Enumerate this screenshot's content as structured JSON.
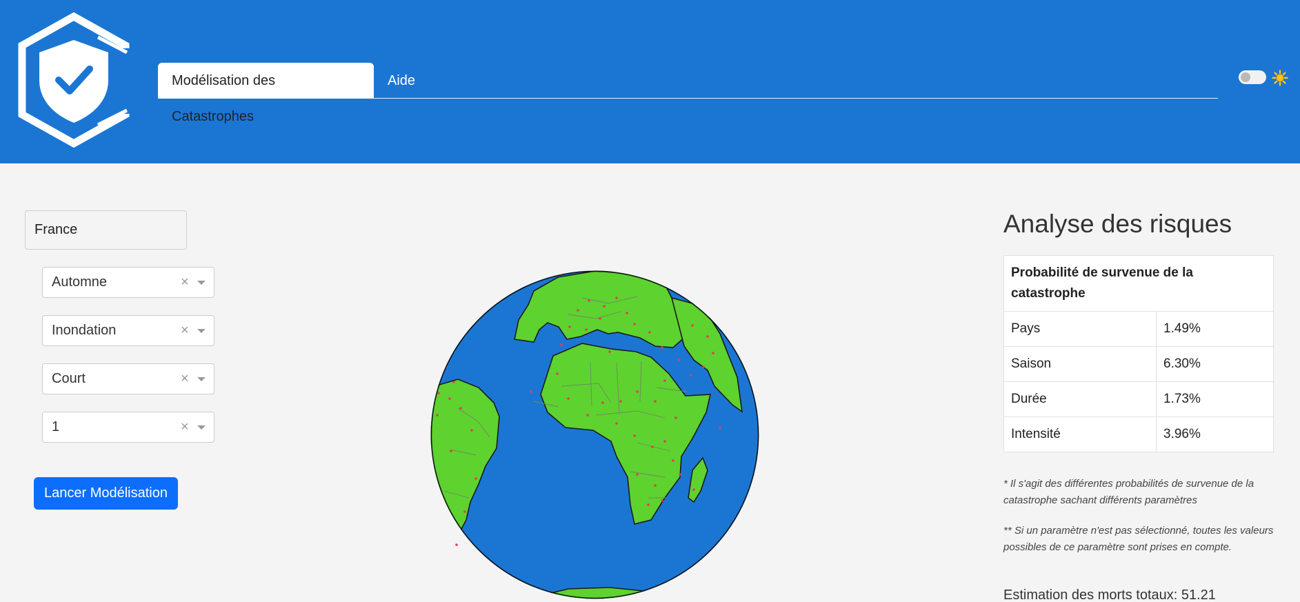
{
  "header": {
    "tabs": [
      {
        "label": "Modélisation des Catastrophes",
        "active": true
      },
      {
        "label": "Aide",
        "active": false
      }
    ],
    "theme_toggle": {
      "state": "off",
      "icon": "sun-icon"
    },
    "logo": "shield-check-logo",
    "colors": {
      "header_bg": "#1b76d3",
      "accent": "#0d6efd"
    }
  },
  "form": {
    "country": {
      "value": "France"
    },
    "selects": [
      {
        "name": "season",
        "value": "Automne"
      },
      {
        "name": "disaster-type",
        "value": "Inondation"
      },
      {
        "name": "duration",
        "value": "Court"
      },
      {
        "name": "intensity",
        "value": "1"
      }
    ],
    "launch_label": "Lancer Modélisation"
  },
  "map": {
    "type": "globe",
    "colors": {
      "ocean": "#1b76d3",
      "land": "#5ed22f",
      "event_points": "#e0404f"
    }
  },
  "analysis": {
    "title": "Analyse des risques",
    "table_header": "Probabilité de survenue de la catastrophe",
    "rows": [
      {
        "label": "Pays",
        "value": "1.49%"
      },
      {
        "label": "Saison",
        "value": "6.30%"
      },
      {
        "label": "Durée",
        "value": "1.73%"
      },
      {
        "label": "Intensité",
        "value": "3.96%"
      }
    ],
    "note1": "* Il s'agit des différentes probabilités de survenue de la catastrophe sachant différents paramètres",
    "note2": "** Si un paramètre n'est pas sélectionné, toutes les valeurs possibles de ce paramètre sont prises en compte.",
    "estimate": "Estimation des morts totaux: 51.21"
  }
}
